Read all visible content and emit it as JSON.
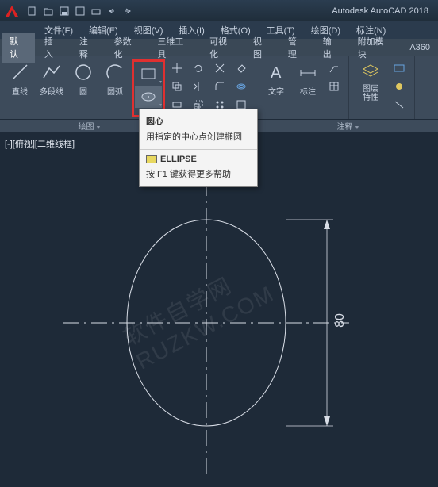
{
  "app_title": "Autodesk AutoCAD 2018",
  "menus": {
    "file": "文件(F)",
    "edit": "编辑(E)",
    "view": "视图(V)",
    "insert": "插入(I)",
    "format": "格式(O)",
    "tools": "工具(T)",
    "draw": "绘图(D)",
    "dim": "标注(N)"
  },
  "tabs": {
    "default": "默认",
    "insert": "插入",
    "annotate": "注释",
    "param": "参数化",
    "3dtools": "三维工具",
    "visualize": "可视化",
    "view": "视图",
    "manage": "管理",
    "output": "输出",
    "addon": "附加模块",
    "a360": "A360"
  },
  "ribbon": {
    "line": "直线",
    "polyline": "多段线",
    "circle": "圆",
    "arc": "圆弧",
    "text": "文字",
    "dimension": "标注",
    "layer_props": "图层\n特性"
  },
  "panel_labels": {
    "draw": "绘图",
    "annotate": "注释"
  },
  "tooltip": {
    "title": "圆心",
    "desc": "用指定的中心点创建椭圆",
    "command": "ELLIPSE",
    "help": "按 F1 键获得更多帮助"
  },
  "viewport_label": "[-][俯视][二维线框]",
  "dimension_value": "80",
  "watermark": "软件自学网 RUZKW.COM",
  "colors": {
    "bg": "#1e2a38",
    "ribbon": "#3d4b5b",
    "highlight": "#e03030"
  }
}
